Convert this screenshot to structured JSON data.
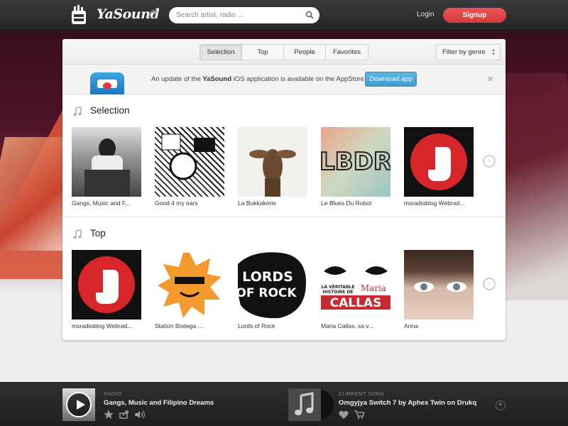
{
  "brand": {
    "name": "YaSound"
  },
  "search": {
    "placeholder": "Search artist, radio ..."
  },
  "auth": {
    "login_label": "Login",
    "signup_label": "Signup"
  },
  "tabs": [
    {
      "label": "Selection",
      "active": true
    },
    {
      "label": "Top",
      "active": false
    },
    {
      "label": "People",
      "active": false
    },
    {
      "label": "Favorites",
      "active": false
    }
  ],
  "filter": {
    "label": "Filter by genre"
  },
  "update_banner": {
    "text_before": "An update of the ",
    "app_name": "YaSound",
    "text_after": " iOS application is available on the AppStore",
    "button_label": "Download app",
    "close_glyph": "✖"
  },
  "sections": [
    {
      "title": "Selection",
      "items": [
        {
          "caption": "Gangs, Music and F...",
          "art": "bw-photo"
        },
        {
          "caption": "Good 4 my ears",
          "art": "bw-illustration"
        },
        {
          "caption": "La Bukkakerie",
          "art": "deer"
        },
        {
          "caption": "Le Blues Du Robot",
          "art": "letters-lbdr"
        },
        {
          "caption": "msradioblog Webrad...",
          "art": "red-logo"
        }
      ]
    },
    {
      "title": "Top",
      "items": [
        {
          "caption": "msradioblog Webrad...",
          "art": "red-logo"
        },
        {
          "caption": "Station Bodega ...",
          "art": "sun"
        },
        {
          "caption": "Lords of Rock",
          "art": "lords-of-rock"
        },
        {
          "caption": "Maria Callas, sa v...",
          "art": "callas"
        },
        {
          "caption": "Anna",
          "art": "eyes"
        }
      ]
    }
  ],
  "art_text": {
    "lords_line1": "LORDS",
    "lords_line2": "OF ROCK",
    "callas_line1": "LA VÉRITABLE",
    "callas_line2": "HISTOIRE DE",
    "callas_name1": "Maria",
    "callas_name2": "CALLAS",
    "lbdr": "LBDR"
  },
  "player": {
    "radio_kicker": "RADIO",
    "radio_title": "Gangs, Music and Filipino Dreams",
    "current_kicker": "CURRENT SONG",
    "current_title": "Omgyjya Switch 7 by Aphex Twin on Drukq"
  },
  "colors": {
    "accent_red": "#e04a4a",
    "download_blue": "#4aa6d8",
    "topbar": "#2c2c2c"
  }
}
